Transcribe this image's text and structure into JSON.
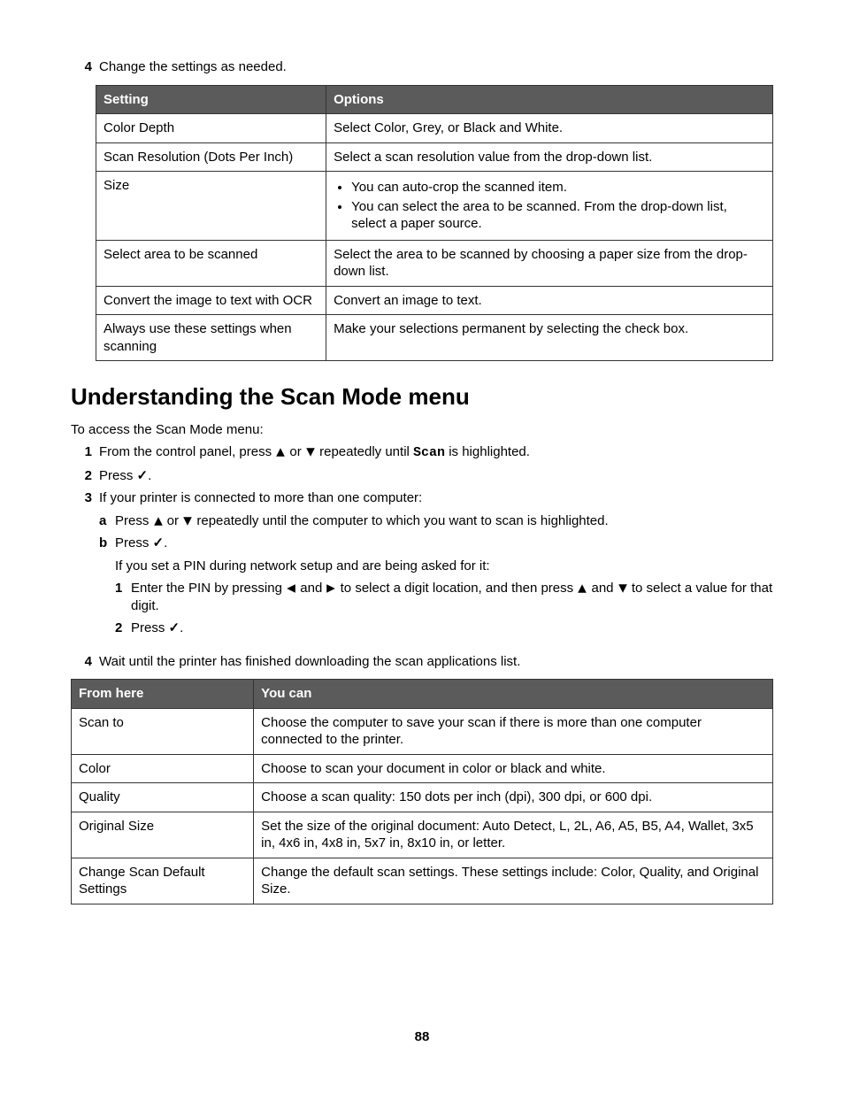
{
  "top_step_num": "4",
  "top_step_text": "Change the settings as needed.",
  "table1": {
    "headers": [
      "Setting",
      "Options"
    ],
    "rows": [
      {
        "c0": "Color Depth",
        "c1": "Select Color, Grey, or Black and White."
      },
      {
        "c0": "Scan Resolution (Dots Per Inch)",
        "c1": "Select a scan resolution value from the drop-down list."
      },
      {
        "c0": "Size",
        "bullets": [
          "You can auto-crop the scanned item.",
          "You can select the area to be scanned. From the drop-down list, select a paper source."
        ]
      },
      {
        "c0": "Select area to be scanned",
        "c1": "Select the area to be scanned by choosing a paper size from the drop-down list."
      },
      {
        "c0": "Convert the image to text with OCR",
        "c1": "Convert an image to text."
      },
      {
        "c0": "Always use these settings when scanning",
        "c1": "Make your selections permanent by selecting the check box."
      }
    ]
  },
  "heading": "Understanding the Scan Mode menu",
  "intro": "To access the Scan Mode menu:",
  "step1_pre": "From the control panel, press ",
  "step1_mid": " or ",
  "step1_post": " repeatedly until ",
  "step1_scan": "Scan",
  "step1_end": " is highlighted.",
  "step2": "Press ",
  "step2_end": ".",
  "step3": "If your printer is connected to more than one computer:",
  "step3a_pre": "Press ",
  "step3a_mid": " or ",
  "step3a_post": " repeatedly until the computer to which you want to scan is highlighted.",
  "step3b": "Press ",
  "step3b_end": ".",
  "pin_line": "If you set a PIN during network setup and are being asked for it:",
  "pin1_pre": "Enter the PIN by pressing ",
  "pin1_and1": " and ",
  "pin1_mid": " to select a digit location, and then press ",
  "pin1_and2": " and ",
  "pin1_post": " to select a value for that digit.",
  "pin2": "Press ",
  "pin2_end": ".",
  "step4": "Wait until the printer has finished downloading the scan applications list.",
  "table2": {
    "headers": [
      "From here",
      "You can"
    ],
    "rows": [
      {
        "c0": "Scan to",
        "c1": "Choose the computer to save your scan if there is more than one computer connected to the printer."
      },
      {
        "c0": "Color",
        "c1": "Choose to scan your document in color or black and white."
      },
      {
        "c0": "Quality",
        "c1": "Choose a scan quality: 150 dots per inch (dpi), 300 dpi, or 600 dpi."
      },
      {
        "c0": "Original Size",
        "c1": "Set the size of the original document: Auto Detect, L, 2L, A6, A5, B5, A4, Wallet, 3x5 in, 4x6 in, 4x8 in, 5x7 in, 8x10 in, or letter."
      },
      {
        "c0": "Change Scan Default Settings",
        "c1": "Change the default scan settings. These settings include: Color, Quality, and Original Size."
      }
    ]
  },
  "page_number": "88"
}
